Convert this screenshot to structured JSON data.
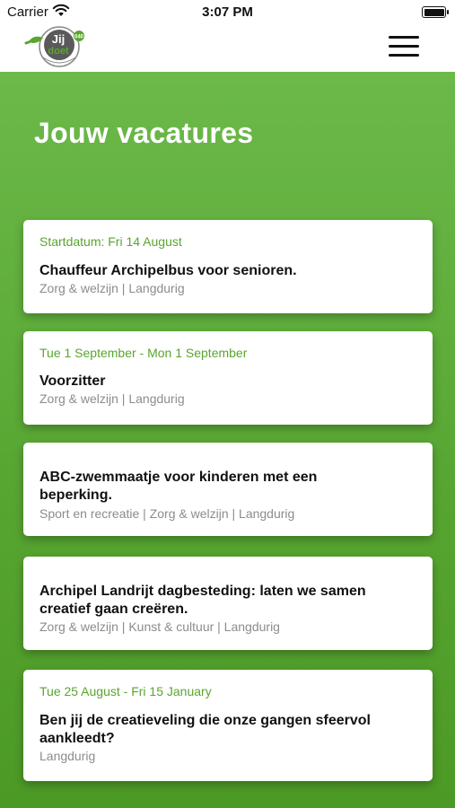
{
  "status_bar": {
    "carrier": "Carrier",
    "time": "3:07 PM",
    "battery_level": 1.0
  },
  "header": {
    "logo": {
      "name": "jij-doet-logo",
      "text_top": "Jij",
      "text_bottom": "doet",
      "badge": "040"
    },
    "menu_icon": "hamburger-menu-icon"
  },
  "page": {
    "title": "Jouw vacatures"
  },
  "colors": {
    "accent": "#5aa52f",
    "background_top": "#6cb94a",
    "background_bottom": "#4c9925",
    "tag_gray": "#8c8c8c"
  },
  "vacancies": [
    {
      "date": "Startdatum: Fri 14 August",
      "title": "Chauffeur Archipelbus voor senioren.",
      "tags": "Zorg & welzijn | Langdurig"
    },
    {
      "date": "Tue 1 September - Mon 1 September",
      "title": "Voorzitter",
      "tags": "Zorg & welzijn | Langdurig"
    },
    {
      "date": "",
      "title": "ABC-zwemmaatje voor kinderen met een beperking.",
      "tags": "Sport en recreatie | Zorg & welzijn | Langdurig"
    },
    {
      "date": "",
      "title": "Archipel Landrijt dagbesteding: laten we samen creatief gaan creëren.",
      "tags": "Zorg & welzijn | Kunst & cultuur | Langdurig"
    },
    {
      "date": "Tue 25 August - Fri 15 January",
      "title": "Ben jij de creatieveling die onze gangen sfeervol aankleedt?",
      "tags": "Langdurig"
    }
  ]
}
